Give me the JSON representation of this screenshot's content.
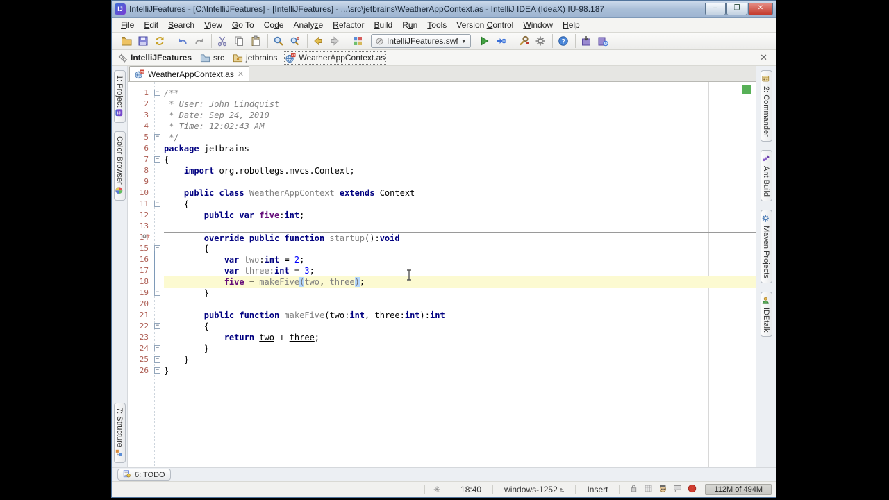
{
  "window": {
    "title": "IntelliJFeatures - [C:\\IntelliJFeatures] - [IntelliJFeatures] - ...\\src\\jetbrains\\WeatherAppContext.as - IntelliJ IDEA (IdeaX) IU-98.187",
    "controls": {
      "minimize": "‒",
      "maximize": "❐",
      "close": "✕"
    }
  },
  "menu": {
    "items": [
      {
        "label": "File",
        "m": 0
      },
      {
        "label": "Edit",
        "m": 0
      },
      {
        "label": "Search",
        "m": 0
      },
      {
        "label": "View",
        "m": 0
      },
      {
        "label": "Go To",
        "m": 0
      },
      {
        "label": "Code",
        "m": 2
      },
      {
        "label": "Analyze",
        "m": 5
      },
      {
        "label": "Refactor",
        "m": 0
      },
      {
        "label": "Build",
        "m": 0
      },
      {
        "label": "Run",
        "m": 1
      },
      {
        "label": "Tools",
        "m": 0
      },
      {
        "label": "Version Control",
        "m": 8
      },
      {
        "label": "Window",
        "m": 0
      },
      {
        "label": "Help",
        "m": 0
      }
    ]
  },
  "toolbar": {
    "groups": [
      [
        "open-project",
        "save-all",
        "synchronize"
      ],
      [
        "undo",
        "redo"
      ],
      [
        "cut",
        "copy",
        "paste"
      ],
      [
        "find",
        "replace"
      ],
      [
        "back",
        "forward"
      ],
      [
        "ide-settings"
      ]
    ],
    "run_combo": {
      "value": "IntelliJFeatures.swf",
      "icon": "run-config"
    },
    "groups_after": [
      [
        "run",
        "debug"
      ],
      [
        "inspect-code",
        "project-settings"
      ],
      [
        "help"
      ],
      [
        "export-settings",
        "save-history"
      ]
    ]
  },
  "navbar": {
    "items": [
      {
        "label": "IntelliJFeatures",
        "icon": "project"
      },
      {
        "label": "src",
        "icon": "folder"
      },
      {
        "label": "jetbrains",
        "icon": "package-folder"
      },
      {
        "label": "WeatherAppContext.as",
        "icon": "as-file"
      }
    ],
    "close": "✕"
  },
  "tabs": [
    {
      "label": "WeatherAppContext.as",
      "icon": "as-file",
      "close": "✕"
    }
  ],
  "stripes": {
    "left_top": [
      {
        "label": "1: Project",
        "icon": "intellij"
      },
      {
        "label": "Color Browser",
        "icon": "color-wheel"
      }
    ],
    "left_bottom": [
      {
        "label": "7: Structure",
        "icon": "structure"
      }
    ],
    "right": [
      {
        "label": "2: Commander",
        "icon": "commander"
      },
      {
        "label": "Ant Build",
        "icon": "ant"
      },
      {
        "label": "Maven Projects",
        "icon": "maven"
      },
      {
        "label": "IDEtalk",
        "icon": "idetalk"
      }
    ],
    "bottom": [
      {
        "label": "6: TODO",
        "icon": "todo",
        "m": 0
      }
    ]
  },
  "editor": {
    "caret_line": 18,
    "separator_above_line": 14,
    "override_marker_line": 14,
    "fold_guide": {
      "from": 15,
      "to": 19
    },
    "folds": {
      "1": "open",
      "5": "end",
      "7": "open",
      "11": "open",
      "15": "open",
      "19": "end",
      "22": "open",
      "24": "end",
      "25": "end",
      "26": "end"
    },
    "lines": [
      {
        "n": 1,
        "parts": [
          [
            "/**",
            "com"
          ]
        ]
      },
      {
        "n": 2,
        "parts": [
          [
            " * User: John Lindquist",
            "com"
          ]
        ]
      },
      {
        "n": 3,
        "parts": [
          [
            " * Date: Sep 24, 2010",
            "com"
          ]
        ]
      },
      {
        "n": 4,
        "parts": [
          [
            " * Time: 12:02:43 AM",
            "com"
          ]
        ]
      },
      {
        "n": 5,
        "parts": [
          [
            " */",
            "com"
          ]
        ]
      },
      {
        "n": 6,
        "parts": [
          [
            "package",
            "kw"
          ],
          [
            " jetbrains",
            "pln"
          ]
        ]
      },
      {
        "n": 7,
        "parts": [
          [
            "{",
            "pln"
          ]
        ]
      },
      {
        "n": 8,
        "parts": [
          [
            "    ",
            "pln"
          ],
          [
            "import",
            "kw"
          ],
          [
            " org.robotlegs.mvcs.Context;",
            "pln"
          ]
        ]
      },
      {
        "n": 9,
        "parts": []
      },
      {
        "n": 10,
        "parts": [
          [
            "    ",
            "pln"
          ],
          [
            "public class",
            "kw"
          ],
          [
            " ",
            "pln"
          ],
          [
            "WeatherAppContext",
            "id"
          ],
          [
            " ",
            "pln"
          ],
          [
            "extends",
            "kw"
          ],
          [
            " Context",
            "pln"
          ]
        ]
      },
      {
        "n": 11,
        "parts": [
          [
            "    {",
            "pln"
          ]
        ]
      },
      {
        "n": 12,
        "parts": [
          [
            "        ",
            "pln"
          ],
          [
            "public var",
            "kw"
          ],
          [
            " ",
            "pln"
          ],
          [
            "five",
            "fld"
          ],
          [
            ":",
            "pln"
          ],
          [
            "int",
            "kw"
          ],
          [
            ";",
            "pln"
          ]
        ]
      },
      {
        "n": 13,
        "parts": []
      },
      {
        "n": 14,
        "parts": [
          [
            "        ",
            "pln"
          ],
          [
            "override public function",
            "kw"
          ],
          [
            " ",
            "pln"
          ],
          [
            "startup",
            "id"
          ],
          [
            "():",
            "pln"
          ],
          [
            "void",
            "kw"
          ]
        ]
      },
      {
        "n": 15,
        "parts": [
          [
            "        {",
            "pln"
          ]
        ]
      },
      {
        "n": 16,
        "parts": [
          [
            "            ",
            "pln"
          ],
          [
            "var",
            "kw"
          ],
          [
            " ",
            "pln"
          ],
          [
            "two",
            "id"
          ],
          [
            ":",
            "pln"
          ],
          [
            "int",
            "kw"
          ],
          [
            " = ",
            "pln"
          ],
          [
            "2",
            "num"
          ],
          [
            ";",
            "pln"
          ]
        ]
      },
      {
        "n": 17,
        "parts": [
          [
            "            ",
            "pln"
          ],
          [
            "var",
            "kw"
          ],
          [
            " ",
            "pln"
          ],
          [
            "three",
            "id"
          ],
          [
            ":",
            "pln"
          ],
          [
            "int",
            "kw"
          ],
          [
            " = ",
            "pln"
          ],
          [
            "3",
            "num"
          ],
          [
            ";",
            "pln"
          ]
        ]
      },
      {
        "n": 18,
        "parts": [
          [
            "            ",
            "pln"
          ],
          [
            "five",
            "fld"
          ],
          [
            " = ",
            "pln"
          ],
          [
            "makeFive",
            "id"
          ],
          [
            "(",
            "brc"
          ],
          [
            "two",
            "id"
          ],
          [
            ", ",
            "pln"
          ],
          [
            "three",
            "id"
          ],
          [
            ")",
            "brc"
          ],
          [
            ";",
            "pln"
          ]
        ]
      },
      {
        "n": 19,
        "parts": [
          [
            "        }",
            "pln"
          ]
        ]
      },
      {
        "n": 20,
        "parts": []
      },
      {
        "n": 21,
        "parts": [
          [
            "        ",
            "pln"
          ],
          [
            "public function",
            "kw"
          ],
          [
            " ",
            "pln"
          ],
          [
            "makeFive",
            "id"
          ],
          [
            "(",
            "pln"
          ],
          [
            "two",
            "par"
          ],
          [
            ":",
            "pln"
          ],
          [
            "int",
            "kw"
          ],
          [
            ", ",
            "pln"
          ],
          [
            "three",
            "par"
          ],
          [
            ":",
            "pln"
          ],
          [
            "int",
            "kw"
          ],
          [
            "):",
            "pln"
          ],
          [
            "int",
            "kw"
          ]
        ]
      },
      {
        "n": 22,
        "parts": [
          [
            "        {",
            "pln"
          ]
        ]
      },
      {
        "n": 23,
        "parts": [
          [
            "            ",
            "pln"
          ],
          [
            "return",
            "kw"
          ],
          [
            " ",
            "pln"
          ],
          [
            "two",
            "par"
          ],
          [
            " + ",
            "pln"
          ],
          [
            "three",
            "par"
          ],
          [
            ";",
            "pln"
          ]
        ]
      },
      {
        "n": 24,
        "parts": [
          [
            "        }",
            "pln"
          ]
        ]
      },
      {
        "n": 25,
        "parts": [
          [
            "    }",
            "pln"
          ]
        ]
      },
      {
        "n": 26,
        "parts": [
          [
            "}",
            "pln"
          ]
        ]
      }
    ],
    "inspection_status_color": "#57b057"
  },
  "status_bar": {
    "caret_position": "18:40",
    "encoding": "windows-1252",
    "input_mode": "Insert",
    "memory": "112M of 494M",
    "icons": [
      "lock",
      "read-only",
      "hector-inspector",
      "event-log",
      "error-notification"
    ],
    "spinner_icon": "background-tasks"
  }
}
